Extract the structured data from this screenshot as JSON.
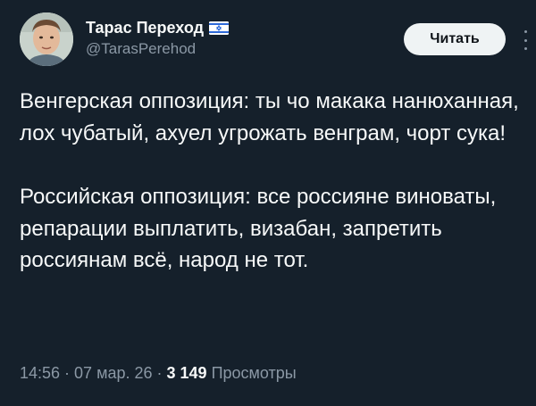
{
  "author": {
    "display_name": "Тарас Переход",
    "handle": "@TarasPerehod",
    "flag_icon": "israel-flag-icon"
  },
  "header": {
    "follow_label": "Читать",
    "more_icon": "more-vertical-icon"
  },
  "tweet": {
    "paragraph_1": "Венгерская оппозиция: ты чо макака нанюханная, лох чубатый, ахуел угрожать венграм, чорт сука!",
    "paragraph_2": "Российская оппозиция: все россияне виноваты, репарации выплатить, визабан, запретить россиянам всё, народ не тот."
  },
  "meta": {
    "time": "14:56",
    "separator": " · ",
    "date": "07 мар. 26",
    "views_count": "3 149",
    "views_label": "Просмотры"
  },
  "colors": {
    "background": "#15202b",
    "text_primary": "#f7f9f9",
    "text_secondary": "#8b98a5",
    "button_bg": "#eff3f4"
  }
}
